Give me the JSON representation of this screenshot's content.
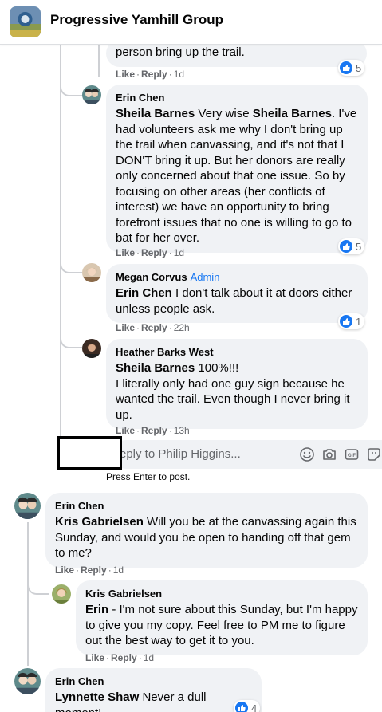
{
  "header": {
    "group_name": "Progressive Yamhill Group"
  },
  "comments": [
    {
      "text": "person bring up the trail.",
      "like": "Like",
      "reply": "Reply",
      "time": "1d",
      "reactions": "5"
    },
    {
      "author": "Erin Chen",
      "mention1": "Sheila Barnes",
      "text1": " Very wise ",
      "mention2": "Sheila Barnes",
      "text2": ". I've had volunteers ask me why I don't bring up the trail when canvassing, and it's not that I DON'T bring it up. But her donors are really only concerned about that one issue. So by focusing on other areas (her conflicts of interest) we have an opportunity to bring forefront issues that no one is willing to go to bat for her over.",
      "like": "Like",
      "reply": "Reply",
      "time": "1d",
      "reactions": "5"
    },
    {
      "author": "Megan Corvus",
      "badge": "Admin",
      "mention1": "Erin Chen",
      "text1": " I don't talk about it at doors either unless people ask.",
      "like": "Like",
      "reply": "Reply",
      "time": "22h",
      "reactions": "1"
    },
    {
      "author": "Heather Barks West",
      "mention1": "Sheila Barnes",
      "text1": " 100%!!!",
      "text2": "I literally only had one guy sign because he wanted the trail. Even though I never bring it up.",
      "like": "Like",
      "reply": "Reply",
      "time": "13h"
    },
    {
      "author": "Erin Chen",
      "mention1": "Kris Gabrielsen",
      "text1": " Will you be at the canvassing again this Sunday, and would you be open to handing off that gem to me?",
      "like": "Like",
      "reply": "Reply",
      "time": "1d"
    },
    {
      "author": "Kris Gabrielsen",
      "mention1": "Erin",
      "text1": " - I'm not sure about this Sunday, but I'm happy to give you my copy. Feel free to PM me to figure out the best way to get it to you.",
      "like": "Like",
      "reply": "Reply",
      "time": "1d"
    },
    {
      "author": "Erin Chen",
      "mention1": "Lynnette Shaw",
      "text1": " Never a dull moment!",
      "reactions": "4"
    }
  ],
  "reply_box": {
    "placeholder": "eply to Philip Higgins...",
    "hint": "Press Enter to post."
  },
  "colors": {
    "accent": "#1877f2",
    "bubble": "#f0f2f5",
    "meta": "#65676b"
  }
}
